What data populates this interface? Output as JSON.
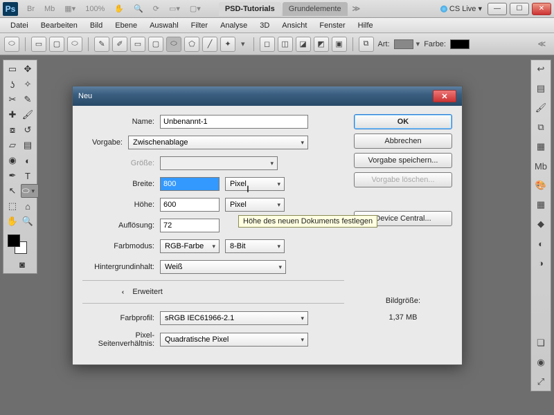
{
  "titlebar": {
    "logo": "Ps",
    "mini1": "Br",
    "mini2": "Mb",
    "zoom": "100%",
    "tab_active": "PSD-Tutorials",
    "tab_inactive": "Grundelemente",
    "cslive": "CS Live"
  },
  "menu": [
    "Datei",
    "Bearbeiten",
    "Bild",
    "Ebene",
    "Auswahl",
    "Filter",
    "Analyse",
    "3D",
    "Ansicht",
    "Fenster",
    "Hilfe"
  ],
  "options": {
    "art": "Art:",
    "farbe": "Farbe:"
  },
  "dialog": {
    "title": "Neu",
    "name_label": "Name:",
    "name_value": "Unbenannt-1",
    "preset_label": "Vorgabe:",
    "preset_value": "Zwischenablage",
    "size_label": "Größe:",
    "width_label": "Breite:",
    "width_value": "800",
    "width_unit": "Pixel",
    "height_label": "Höhe:",
    "height_value": "600",
    "height_unit": "Pixel",
    "res_label": "Auflösung:",
    "res_value": "72",
    "mode_label": "Farbmodus:",
    "mode_value": "RGB-Farbe",
    "depth_value": "8-Bit",
    "bg_label": "Hintergrundinhalt:",
    "bg_value": "Weiß",
    "advanced": "Erweitert",
    "profile_label": "Farbprofil:",
    "profile_value": "sRGB IEC61966-2.1",
    "par_label": "Pixel-Seitenverhältnis:",
    "par_value": "Quadratische Pixel",
    "ok": "OK",
    "cancel": "Abbrechen",
    "save_preset": "Vorgabe speichern...",
    "delete_preset": "Vorgabe löschen...",
    "device_central": "Device Central...",
    "size_heading": "Bildgröße:",
    "size_value": "1,37 MB"
  },
  "tooltip": "Höhe des neuen Dokuments festlegen"
}
